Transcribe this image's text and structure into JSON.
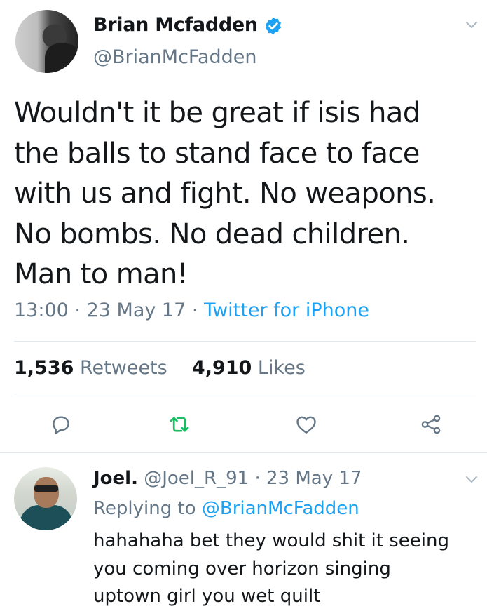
{
  "tweet": {
    "author_name": "Brian Mcfadden",
    "author_handle": "@BrianMcFadden",
    "verified": true,
    "text_lines": [
      "Wouldn't it be great if isis had",
      "the balls to stand face to face",
      "with us and fight. No weapons.",
      "No bombs. No dead children.",
      "Man to man!"
    ],
    "time": "13:00",
    "date": "23 May 17",
    "source": "Twitter for iPhone",
    "retweets_count": "1,536",
    "retweets_label": "Retweets",
    "likes_count": "4,910",
    "likes_label": "Likes"
  },
  "reply": {
    "author_name": "Joel.",
    "author_handle": "@Joel_R_91",
    "date": "23 May 17",
    "replying_prefix": "Replying to",
    "replying_to": "@BrianMcFadden",
    "text_lines": [
      "hahahaha bet they would shit it seeing",
      "you coming over horizon singing",
      "uptown girl you wet quilt"
    ]
  },
  "icons": {
    "verified": "verified-badge-icon",
    "menu": "chevron-down-icon",
    "reply": "reply-icon",
    "retweet": "retweet-icon",
    "like": "heart-icon",
    "share": "share-icon"
  },
  "colors": {
    "accent": "#1da1f2",
    "retweet": "#17bf63",
    "secondary_text": "#657786",
    "text": "#14171a",
    "divider": "#e1e8ed"
  }
}
